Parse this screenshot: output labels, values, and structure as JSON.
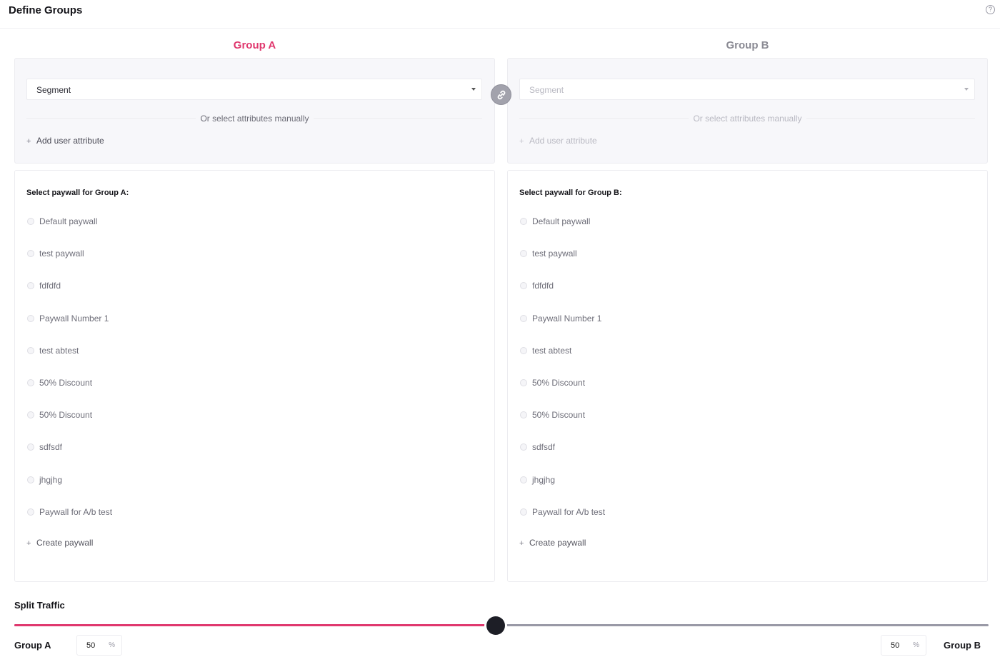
{
  "header": {
    "title": "Define Groups",
    "help_icon": "?"
  },
  "groups": {
    "a": {
      "title": "Group A",
      "title_color": "#e0386e",
      "segment_label": "Segment",
      "divider_text": "Or select attributes manually",
      "add_attribute_label": "Add user attribute",
      "plus": "+",
      "paywall_title": "Select paywall for Group A:",
      "paywalls": [
        "Default paywall",
        "test paywall",
        "fdfdfd",
        "Paywall Number 1",
        "test abtest",
        "50% Discount",
        "50% Discount",
        "sdfsdf",
        "jhgjhg",
        "Paywall for A/b test"
      ],
      "create_paywall_label": "Create paywall"
    },
    "b": {
      "title": "Group B",
      "title_color": "#8b8b94",
      "segment_label": "Segment",
      "divider_text": "Or select attributes manually",
      "add_attribute_label": "Add user attribute",
      "plus": "+",
      "paywall_title": "Select paywall for Group B:",
      "paywalls": [
        "Default paywall",
        "test paywall",
        "fdfdfd",
        "Paywall Number 1",
        "test abtest",
        "50% Discount",
        "50% Discount",
        "sdfsdf",
        "jhgjhg",
        "Paywall for A/b test"
      ],
      "create_paywall_label": "Create paywall"
    }
  },
  "split": {
    "title": "Split Traffic",
    "group_a_label": "Group A",
    "group_b_label": "Group B",
    "group_a_percent": "50",
    "group_b_percent": "50",
    "percent_sign": "%",
    "slider_fraction_group_a": 0.5,
    "accent_color": "#e0386e"
  }
}
